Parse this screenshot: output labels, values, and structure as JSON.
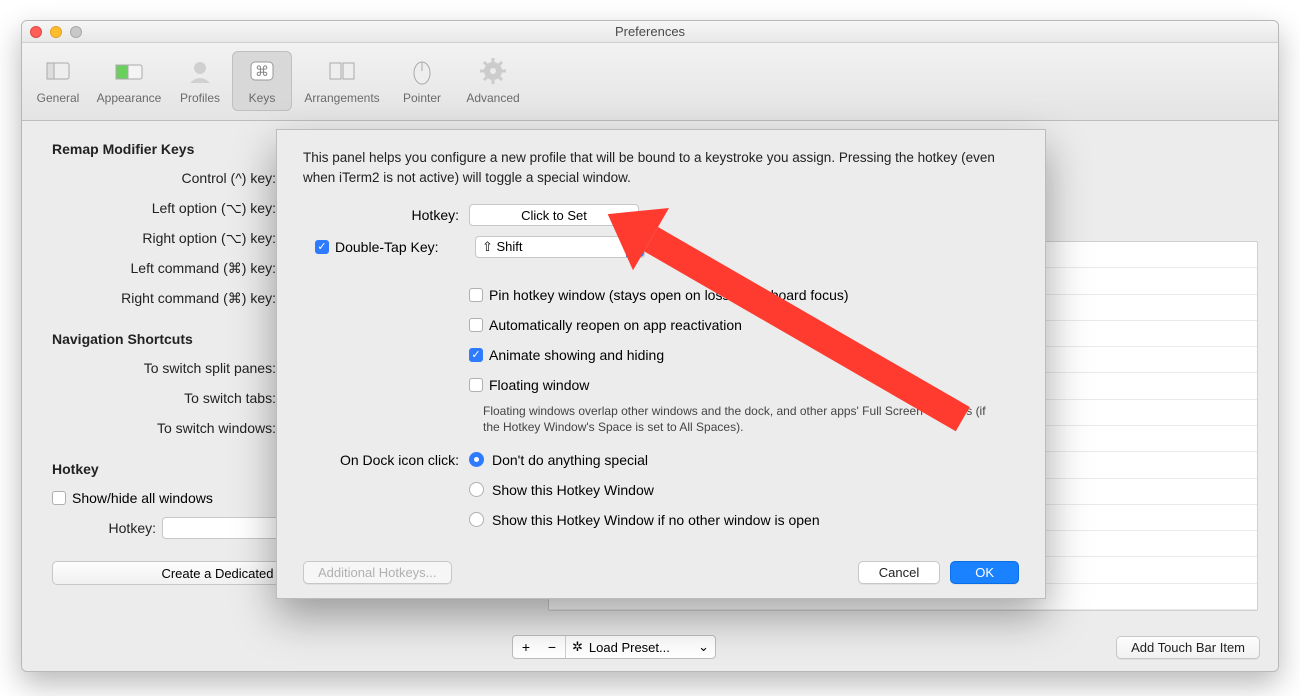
{
  "window_title": "Preferences",
  "tabs": [
    {
      "label": "General"
    },
    {
      "label": "Appearance"
    },
    {
      "label": "Profiles"
    },
    {
      "label": "Keys"
    },
    {
      "label": "Arrangements"
    },
    {
      "label": "Pointer"
    },
    {
      "label": "Advanced"
    }
  ],
  "background": {
    "section_remap": "Remap Modifier Keys",
    "remap_rows": [
      "Control (^) key:",
      "Left option (⌥) key:",
      "Right option (⌥) key:",
      "Left command (⌘) key:",
      "Right command (⌘) key:"
    ],
    "section_nav": "Navigation Shortcuts",
    "nav_rows": [
      "To switch split panes:",
      "To switch tabs:",
      "To switch windows:"
    ],
    "section_hotkey": "Hotkey",
    "showhide_label": "Show/hide all windows",
    "hotkey_label": "Hotkey:",
    "dedicated_btn": "Create a Dedicated Hotkey Window...",
    "load_preset": "Load Preset...",
    "add_touch_bar": "Add Touch Bar Item"
  },
  "sheet": {
    "intro": "This panel helps you configure a new profile that will be bound to a keystroke you assign. Pressing the hotkey (even when iTerm2 is not active) will toggle a special window.",
    "hotkey_label": "Hotkey:",
    "click_to_set": "Click to Set",
    "double_tap_label": "Double-Tap Key:",
    "double_tap_value": "⇧ Shift",
    "pin_label": "Pin hotkey window (stays open on loss of keyboard focus)",
    "auto_reopen_label": "Automatically reopen on app reactivation",
    "animate_label": "Animate showing and hiding",
    "floating_label": "Floating window",
    "floating_help": "Floating windows overlap other windows and the dock, and other apps' Full Screen windows (if the Hotkey Window's Space is set to All Spaces).",
    "dock_label": "On Dock icon click:",
    "dock_options": [
      "Don't do anything special",
      "Show this Hotkey Window",
      "Show this Hotkey Window if no other window is open"
    ],
    "additional_hotkeys": "Additional Hotkeys...",
    "cancel": "Cancel",
    "ok": "OK"
  }
}
